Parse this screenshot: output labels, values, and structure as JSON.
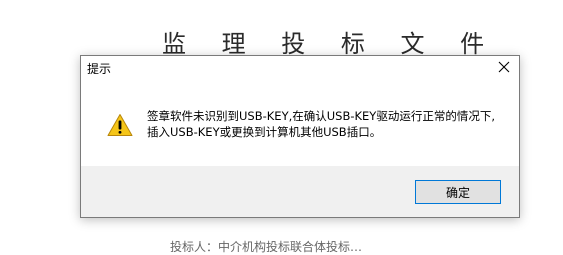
{
  "background": {
    "heading": "监 理 投 标 文 件",
    "bottom_text": "投标人：中介机构投标联合体投标…"
  },
  "dialog": {
    "title": "提示",
    "icon": "warning-icon",
    "message_line1": "签章软件未识别到USB-KEY,在确认USB-KEY驱动运行正常的情况下,",
    "message_line2": "插入USB-KEY或更换到计算机其他USB插口。",
    "ok_label": "确定"
  },
  "colors": {
    "warning_yellow": "#f5c518",
    "accent_border": "#0078d7",
    "footer_bg": "#f0f0f0"
  }
}
